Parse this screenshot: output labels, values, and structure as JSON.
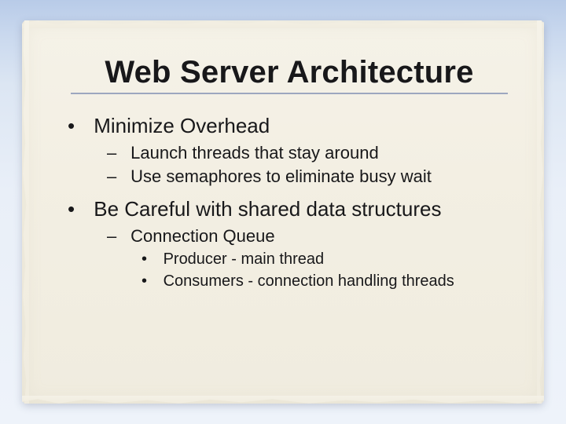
{
  "title": "Web Server Architecture",
  "bullets": {
    "p1": "Minimize Overhead",
    "p1a": "Launch threads that stay around",
    "p1b": "Use semaphores to eliminate busy wait",
    "p2": "Be Careful with shared data structures",
    "p2a": "Connection Queue",
    "p2a_i": "Producer - main thread",
    "p2a_ii": "Consumers - connection handling threads"
  }
}
